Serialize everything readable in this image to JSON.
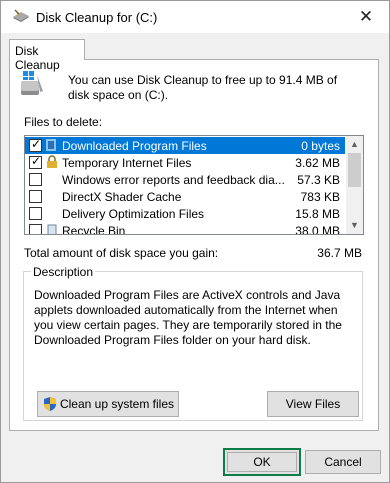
{
  "window": {
    "title": "Disk Cleanup for  (C:)",
    "close_glyph": "✕"
  },
  "tab": {
    "label": "Disk Cleanup"
  },
  "info": {
    "text": "You can use Disk Cleanup to free up to 91.4 MB of disk space on  (C:)."
  },
  "files": {
    "label": "Files to delete:",
    "items": [
      {
        "name": "Downloaded Program Files",
        "size": "0 bytes",
        "checked": true,
        "selected": true,
        "icon": "folder-icon"
      },
      {
        "name": "Temporary Internet Files",
        "size": "3.62 MB",
        "checked": true,
        "selected": false,
        "icon": "lock-icon"
      },
      {
        "name": "Windows error reports and feedback dia...",
        "size": "57.3 KB",
        "checked": false,
        "selected": false,
        "icon": ""
      },
      {
        "name": "DirectX Shader Cache",
        "size": "783 KB",
        "checked": false,
        "selected": false,
        "icon": ""
      },
      {
        "name": "Delivery Optimization Files",
        "size": "15.8 MB",
        "checked": false,
        "selected": false,
        "icon": ""
      },
      {
        "name": "Recycle Bin",
        "size": "38.0 MB",
        "checked": false,
        "selected": false,
        "icon": "recycle-bin-icon"
      }
    ]
  },
  "total": {
    "label": "Total amount of disk space you gain:",
    "value": "36.7 MB"
  },
  "description": {
    "legend": "Description",
    "text": "Downloaded Program Files are ActiveX controls and Java applets downloaded automatically from the Internet when you view certain pages. They are temporarily stored in the Downloaded Program Files folder on your hard disk."
  },
  "buttons": {
    "cleanup": "Clean up system files",
    "view_files": "View Files",
    "ok": "OK",
    "cancel": "Cancel"
  },
  "colors": {
    "selection": "#0078d7",
    "ok_border": "#0f7b48"
  }
}
